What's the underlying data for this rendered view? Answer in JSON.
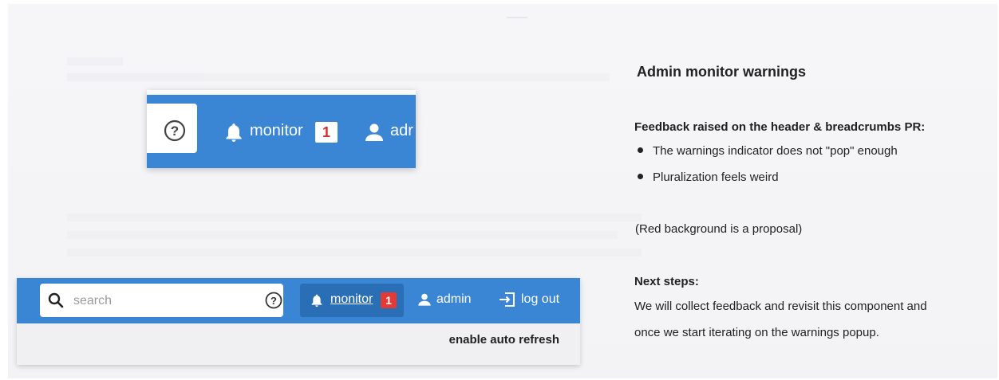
{
  "right_panel": {
    "title": "Admin monitor warnings",
    "feedback_heading": "Feedback raised on the header & breadcrumbs PR:",
    "feedback_items": [
      "The warnings indicator does not \"pop\" enough",
      "Pluralization feels weird"
    ],
    "proposal_note": "(Red background is a proposal)",
    "next_steps_heading": "Next steps:",
    "next_steps_lines": [
      "We will collect feedback and revisit this component and",
      "once we start iterating on the warnings popup."
    ]
  },
  "crop_zoomed": {
    "monitor_label": "monitor",
    "badge_count": "1",
    "user_label_partial": "adr",
    "icons": [
      "help-circle-icon",
      "bell-icon",
      "person-icon"
    ]
  },
  "crop_header": {
    "search_placeholder": "search",
    "monitor_label": "monitor",
    "badge_count": "1",
    "admin_label": "admin",
    "logout_label": "log out",
    "auto_refresh_label": "enable auto refresh",
    "icons": [
      "search-icon",
      "help-circle-icon",
      "bell-icon",
      "person-icon",
      "logout-icon"
    ]
  },
  "colors": {
    "header_blue": "#3a86d4",
    "active_blue": "#2a6fb6",
    "badge_red": "#e53935",
    "badge_red_text": "#d32f2f"
  }
}
